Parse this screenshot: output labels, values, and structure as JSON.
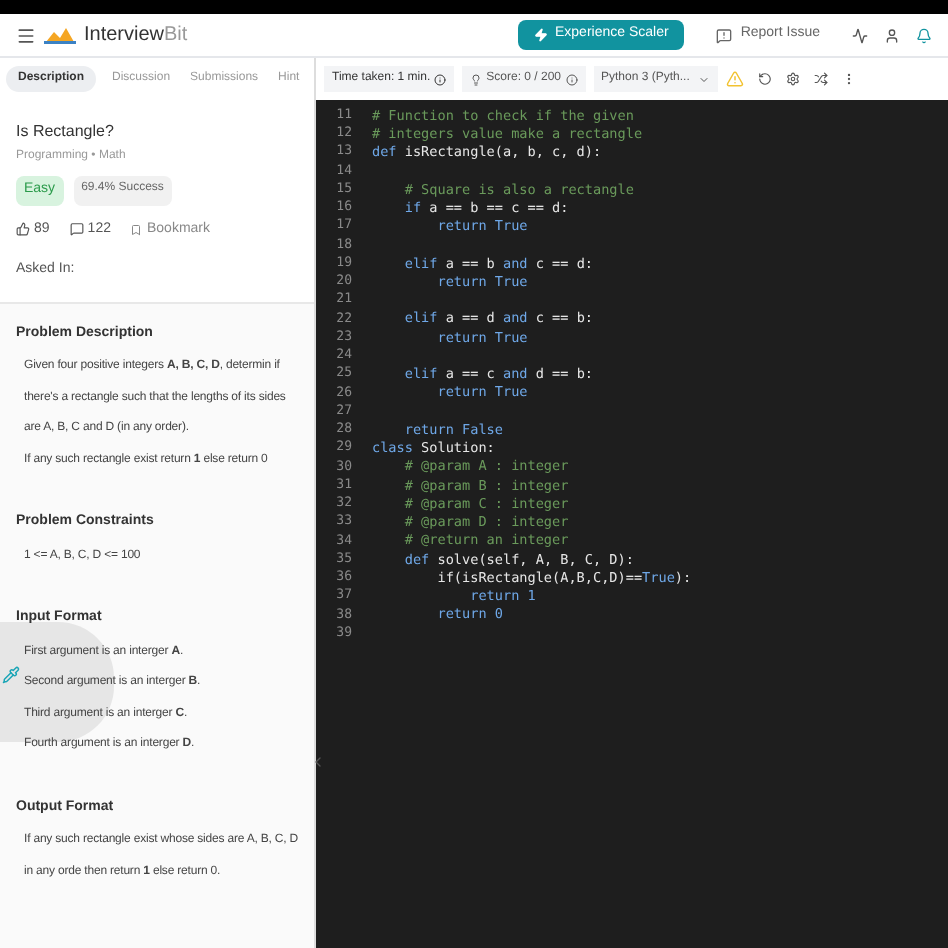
{
  "header": {
    "logo": {
      "main": "Interview",
      "suffix": "Bit"
    },
    "cta": "Experience Scaler",
    "report": "Report Issue"
  },
  "tabs": [
    {
      "label": "Description",
      "selected": true
    },
    {
      "label": "Discussion",
      "selected": false
    },
    {
      "label": "Submissions",
      "selected": false
    },
    {
      "label": "Hint",
      "selected": false
    }
  ],
  "toolbar": {
    "time": "Time taken: 1 min.",
    "score": "Score: 0 / 200",
    "language": "Python 3 (Pyth..."
  },
  "problem": {
    "title": "Is Rectangle?",
    "tags": "Programming • Math",
    "difficulty": "Easy",
    "success": "69.4% Success",
    "likes": "89",
    "comments": "122",
    "bookmark": "Bookmark",
    "asked_in": "Asked In:",
    "sections": [
      {
        "heading": "Problem Description",
        "paragraphs": [
          "Given four positive integers **A, B, C, D**, determin if there's a rectangle such that the lengths of its sides are A, B, C and D (in any order).",
          "If any such rectangle exist return **1** else return 0"
        ]
      },
      {
        "heading": "Problem Constraints",
        "paragraphs": [
          "1 <= A, B, C, D <= 100"
        ]
      },
      {
        "heading": "Input Format",
        "paragraphs": [
          "First argument is an interger **A**.",
          "Second argument is an interger **B**.",
          "Third argument is an interger **C**.",
          "Fourth argument is an interger **D**."
        ]
      },
      {
        "heading": "Output Format",
        "paragraphs": [
          "If any such rectangle exist whose sides are A, B, C, D in any orde then return **1** else return 0."
        ]
      }
    ]
  },
  "editor": {
    "lines": [
      {
        "no": "11",
        "segs": [
          {
            "t": "# Function to check if the given",
            "kind": "cm"
          }
        ]
      },
      {
        "no": "12",
        "segs": [
          {
            "t": "# integers value make a rectangle",
            "kind": "cm"
          }
        ]
      },
      {
        "no": "13",
        "segs": [
          {
            "t": "def",
            "kind": "kw"
          },
          {
            "t": " isRectangle(a, b, c, d):",
            "kind": "tx"
          }
        ]
      },
      {
        "no": "14"
      },
      {
        "no": "15",
        "segs": [
          {
            "t": "    # Square is also a rectangle",
            "kind": "cm"
          }
        ]
      },
      {
        "no": "16",
        "segs": [
          {
            "t": "    if",
            "kind": "kw"
          },
          {
            "t": " a == b == c == d:",
            "kind": "tx"
          }
        ]
      },
      {
        "no": "17",
        "segs": [
          {
            "t": "        return True",
            "kind": "kw"
          }
        ]
      },
      {
        "no": "18"
      },
      {
        "no": "19",
        "segs": [
          {
            "t": "    elif",
            "kind": "kw"
          },
          {
            "t": " a == b ",
            "kind": "tx"
          },
          {
            "t": "and",
            "kind": "kw"
          },
          {
            "t": " c == d:",
            "kind": "tx"
          }
        ]
      },
      {
        "no": "20",
        "segs": [
          {
            "t": "        return True",
            "kind": "kw"
          }
        ]
      },
      {
        "no": "21"
      },
      {
        "no": "22",
        "segs": [
          {
            "t": "    elif",
            "kind": "kw"
          },
          {
            "t": " a == d ",
            "kind": "tx"
          },
          {
            "t": "and",
            "kind": "kw"
          },
          {
            "t": " c == b:",
            "kind": "tx"
          }
        ]
      },
      {
        "no": "23",
        "segs": [
          {
            "t": "        return True",
            "kind": "kw"
          }
        ]
      },
      {
        "no": "24"
      },
      {
        "no": "25",
        "segs": [
          {
            "t": "    elif",
            "kind": "kw"
          },
          {
            "t": " a == c ",
            "kind": "tx"
          },
          {
            "t": "and",
            "kind": "kw"
          },
          {
            "t": " d == b:",
            "kind": "tx"
          }
        ]
      },
      {
        "no": "26",
        "segs": [
          {
            "t": "        return True",
            "kind": "kw"
          }
        ]
      },
      {
        "no": "27"
      },
      {
        "no": "28",
        "segs": [
          {
            "t": "    return False",
            "kind": "kw"
          }
        ]
      },
      {
        "no": "29",
        "segs": [
          {
            "t": "class",
            "kind": "kw"
          },
          {
            "t": " Solution:",
            "kind": "tx"
          }
        ]
      },
      {
        "no": "30",
        "segs": [
          {
            "t": "    # @param A : integer",
            "kind": "cm"
          }
        ]
      },
      {
        "no": "31",
        "segs": [
          {
            "t": "    # @param B : integer",
            "kind": "cm"
          }
        ]
      },
      {
        "no": "32",
        "segs": [
          {
            "t": "    # @param C : integer",
            "kind": "cm"
          }
        ]
      },
      {
        "no": "33",
        "segs": [
          {
            "t": "    # @param D : integer",
            "kind": "cm"
          }
        ]
      },
      {
        "no": "34",
        "segs": [
          {
            "t": "    # @return an integer",
            "kind": "cm"
          }
        ]
      },
      {
        "no": "35",
        "segs": [
          {
            "t": "    def",
            "kind": "kw"
          },
          {
            "t": " solve(self, A, B, C, D):",
            "kind": "tx"
          }
        ]
      },
      {
        "no": "36",
        "segs": [
          {
            "t": "        if(isRectangle(A,B,C,D)==",
            "kind": "tx"
          },
          {
            "t": "True",
            "kind": "kw"
          },
          {
            "t": "):",
            "kind": "tx"
          }
        ]
      },
      {
        "no": "37",
        "segs": [
          {
            "t": "            return 1",
            "kind": "kw"
          }
        ]
      },
      {
        "no": "38",
        "segs": [
          {
            "t": "        return 0",
            "kind": "kw"
          }
        ]
      },
      {
        "no": "39"
      }
    ]
  }
}
